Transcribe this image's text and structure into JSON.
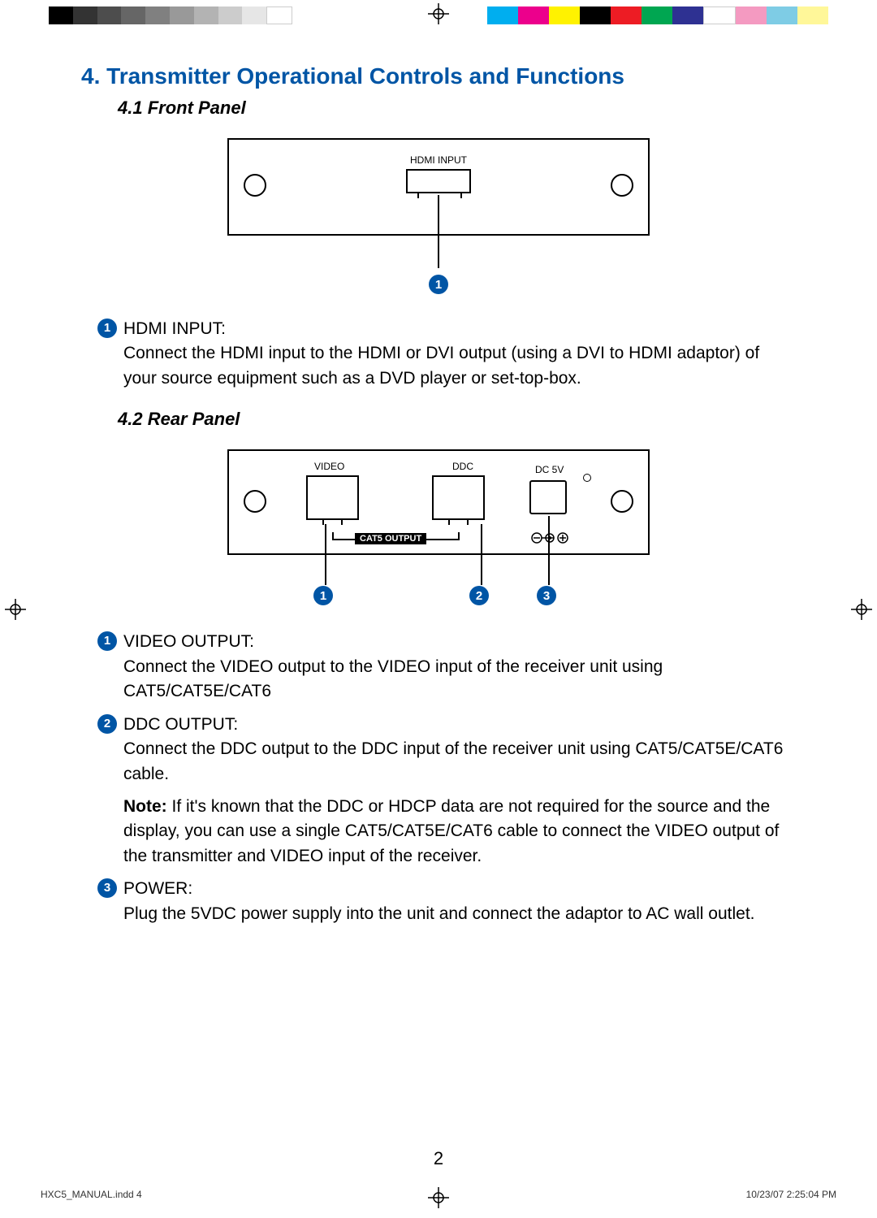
{
  "section_title": "4. Transmitter Operational Controls and Functions",
  "subsection_front": "4.1 Front Panel",
  "subsection_rear": "4.2 Rear Panel",
  "front": {
    "port_label": "HDMI INPUT",
    "callouts": [
      "1"
    ],
    "items": [
      {
        "num": "1",
        "title": "HDMI INPUT:",
        "body": "Connect the HDMI input to the HDMI or DVI output (using a DVI to HDMI adaptor) of your source equipment such as a DVD player or set-top-box."
      }
    ]
  },
  "rear": {
    "labels": {
      "video": "VIDEO",
      "ddc": "DDC",
      "dc": "DC 5V",
      "cat5": "CAT5 OUTPUT"
    },
    "callouts": [
      "1",
      "2",
      "3"
    ],
    "items": [
      {
        "num": "1",
        "title": "VIDEO OUTPUT:",
        "body": "Connect the VIDEO output to the VIDEO input of the receiver unit using CAT5/CAT5E/CAT6"
      },
      {
        "num": "2",
        "title": "DDC OUTPUT:",
        "body": "Connect the DDC output to the DDC input of the receiver unit using CAT5/CAT5E/CAT6 cable."
      },
      {
        "note_label": "Note:",
        "note_body": "If it's known that the DDC or HDCP data are not required for the source and the display, you can use a single CAT5/CAT5E/CAT6 cable to connect the VIDEO output of the transmitter and VIDEO input of the receiver."
      },
      {
        "num": "3",
        "title": "POWER:",
        "body": "Plug the 5VDC power supply into the unit and connect the adaptor to AC wall outlet."
      }
    ]
  },
  "page_number": "2",
  "footer_left": "HXC5_MANUAL.indd   4",
  "footer_right": "10/23/07   2:25:04 PM",
  "colorbar_left": [
    "#000000",
    "#333333",
    "#4d4d4d",
    "#666666",
    "#808080",
    "#999999",
    "#b3b3b3",
    "#cccccc",
    "#e6e6e6",
    "#ffffff"
  ],
  "colorbar_right": [
    "#00aeef",
    "#ec008c",
    "#fff200",
    "#000000",
    "#ed1c24",
    "#00a651",
    "#2e3192",
    "#ffffff",
    "#f49ac1",
    "#00aeef",
    "#fff200"
  ]
}
